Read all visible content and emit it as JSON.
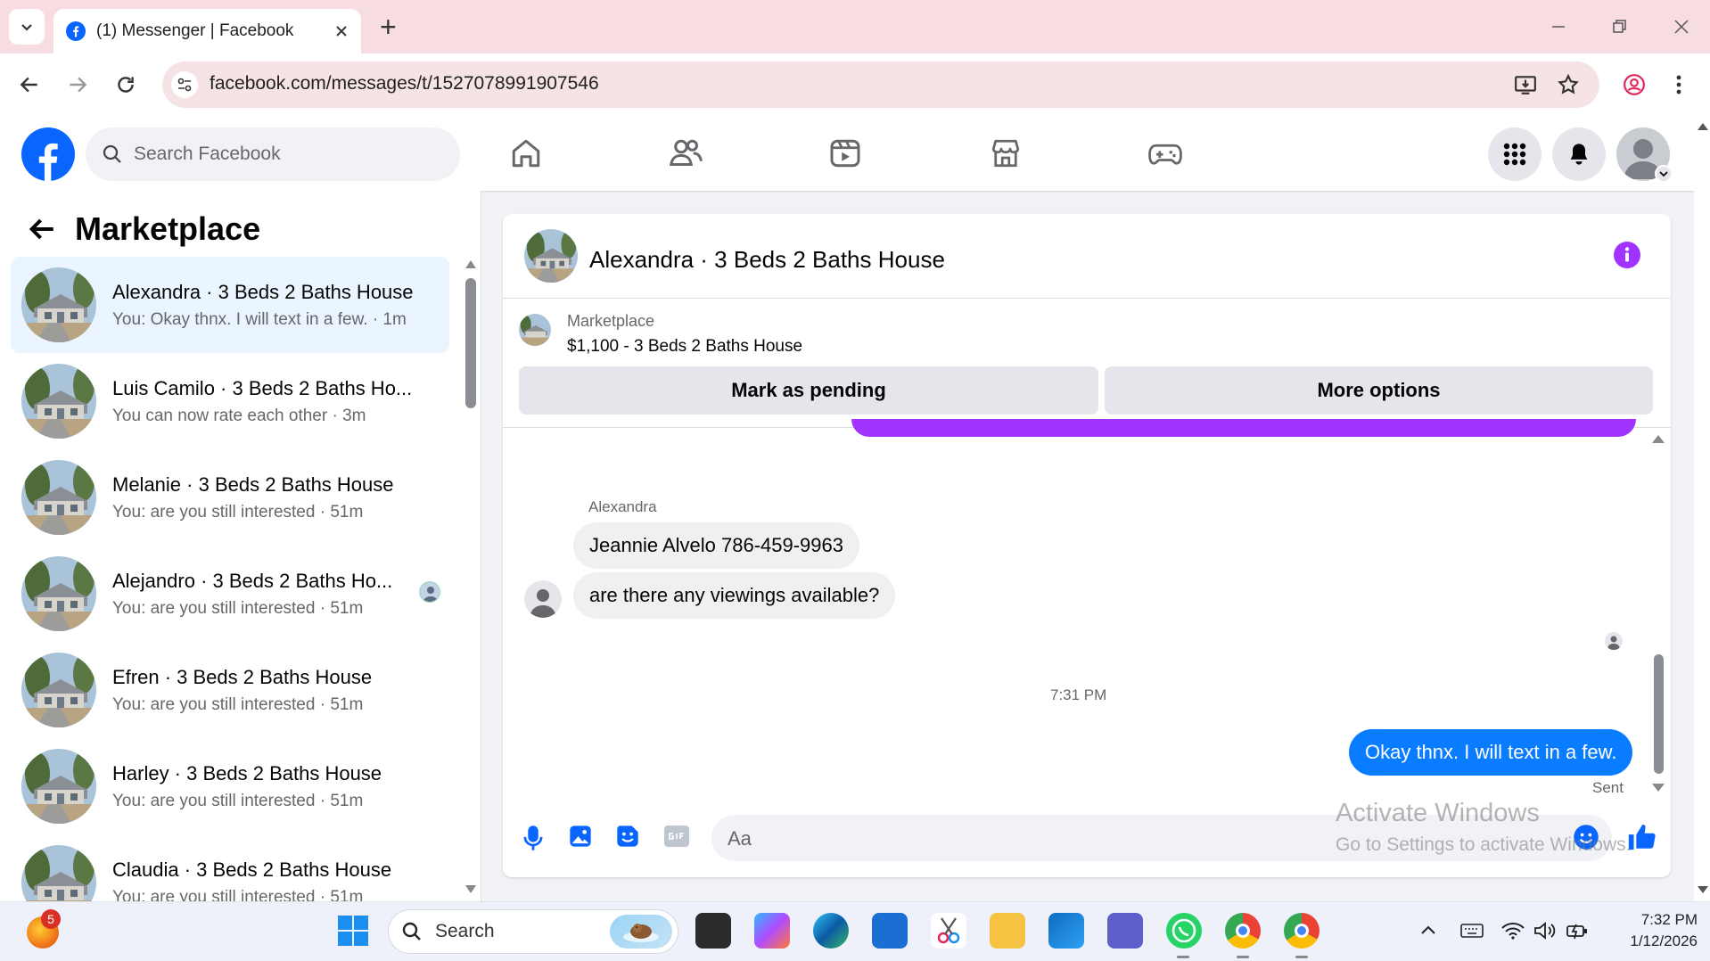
{
  "browser": {
    "tab_title": "(1) Messenger | Facebook",
    "new_tab": "+",
    "url": "facebook.com/messages/t/1527078991907546"
  },
  "fb_header": {
    "search_placeholder": "Search Facebook"
  },
  "sidebar": {
    "title": "Marketplace",
    "conversations": [
      {
        "name": "Alexandra · 3 Beds 2 Baths House",
        "preview": "You: Okay thnx. I will text in a few. · 1m",
        "active": true
      },
      {
        "name": "Luis Camilo · 3 Beds 2 Baths Ho...",
        "preview": "You can now rate each other · 3m"
      },
      {
        "name": "Melanie · 3 Beds 2 Baths House",
        "preview": "You: are you still interested · 51m"
      },
      {
        "name": "Alejandro · 3 Beds 2 Baths Ho...",
        "preview": "You: are you still interested · 51m"
      },
      {
        "name": "Efren · 3 Beds 2 Baths House",
        "preview": "You: are you still interested · 51m"
      },
      {
        "name": "Harley · 3 Beds 2 Baths House",
        "preview": "You: are you still interested · 51m"
      },
      {
        "name": "Claudia · 3 Beds 2 Baths House",
        "preview": "You: are you still interested · 51m"
      }
    ]
  },
  "chat": {
    "title": "Alexandra · 3 Beds 2 Baths House",
    "marketplace_label": "Marketplace",
    "listing": "$1,100 - 3 Beds 2 Baths House",
    "mark_pending": "Mark as pending",
    "more_options": "More options",
    "sender_name": "Alexandra",
    "incoming": [
      "Jeannie Alvelo 786-459-9963",
      "are there any viewings available?"
    ],
    "timestamp": "7:31 PM",
    "outgoing": "Okay thnx. I will text in a few.",
    "status": "Sent",
    "input_placeholder": "Aa"
  },
  "watermark": {
    "line1": "Activate Windows",
    "line2": "Go to Settings to activate Windows."
  },
  "taskbar": {
    "search_label": "Search",
    "time": "7:32 PM",
    "date": "1/12/2026",
    "notification_count": "5"
  },
  "colors": {
    "fb_blue": "#0866ff",
    "bubble_blue": "#0a7cff",
    "messenger_purple": "#a033ff"
  }
}
